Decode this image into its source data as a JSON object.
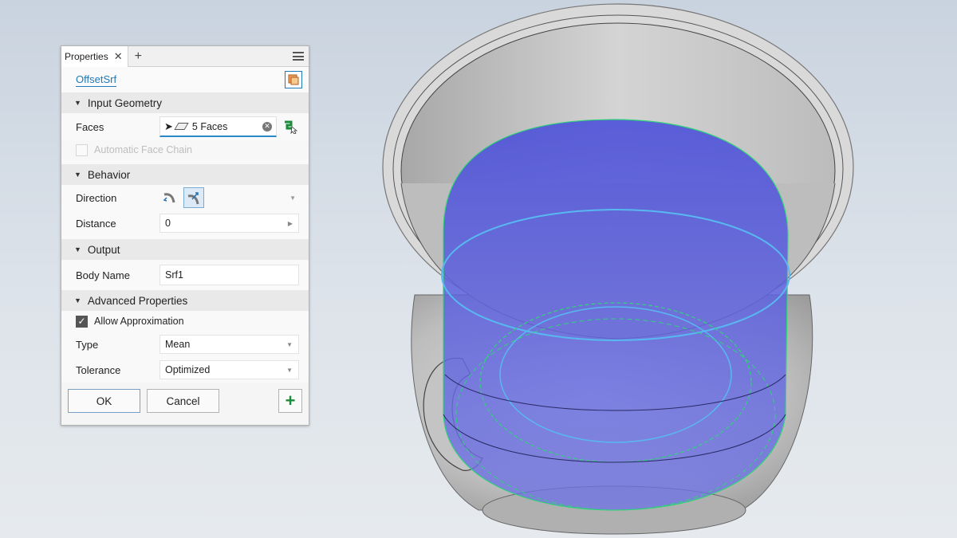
{
  "panel": {
    "tab_label": "Properties",
    "tab_close": "✕",
    "tab_add": "+",
    "feature_name": "OffsetSrf",
    "sections": {
      "input_geometry": "Input Geometry",
      "behavior": "Behavior",
      "output": "Output",
      "advanced": "Advanced Properties"
    },
    "faces": {
      "label": "Faces",
      "value": "5 Faces"
    },
    "automatic_face_chain": {
      "label": "Automatic Face Chain",
      "checked": false,
      "enabled": false
    },
    "direction": {
      "label": "Direction",
      "selected": "second"
    },
    "distance": {
      "label": "Distance",
      "value": "0"
    },
    "body_name": {
      "label": "Body Name",
      "value": "Srf1"
    },
    "allow_approximation": {
      "label": "Allow Approximation",
      "checked": true
    },
    "type": {
      "label": "Type",
      "value": "Mean"
    },
    "tolerance": {
      "label": "Tolerance",
      "value": "Optimized"
    },
    "buttons": {
      "ok": "OK",
      "cancel": "Cancel",
      "add": "+"
    }
  },
  "viewport": {
    "model": "cup-with-handle",
    "selection_color": "#5a5ee0",
    "edge_highlight_color": "#2fd37a",
    "model_color": "#c8c8c8"
  },
  "icons": [
    "select-arrow-icon",
    "face-icon",
    "clear-icon",
    "chain-select-icon",
    "menu-icon",
    "preset-icon",
    "flip-direction-icon",
    "offset-direction-icon"
  ]
}
